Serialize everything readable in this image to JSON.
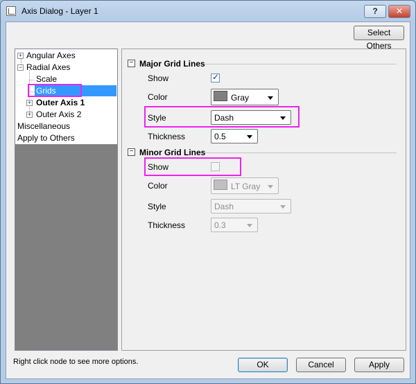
{
  "window": {
    "title": "Axis Dialog - Layer 1",
    "help_label": "?",
    "close_label": "✕"
  },
  "toolbar": {
    "select_others_label": "Select Others"
  },
  "tree": {
    "angular_axes": "Angular Axes",
    "radial_axes": "Radial Axes",
    "scale": "Scale",
    "grids": "Grids",
    "outer_axis_1": "Outer Axis 1",
    "outer_axis_2": "Outer Axis 2",
    "miscellaneous": "Miscellaneous",
    "apply_to_others": "Apply to Others",
    "expand_glyph": "+",
    "collapse_glyph": "−"
  },
  "major": {
    "title": "Major Grid Lines",
    "toggle_glyph": "−",
    "show_label": "Show",
    "show_checked": true,
    "color_label": "Color",
    "color_value": "Gray",
    "color_hex": "#808080",
    "style_label": "Style",
    "style_value": "Dash",
    "thickness_label": "Thickness",
    "thickness_value": "0.5"
  },
  "minor": {
    "title": "Minor Grid Lines",
    "toggle_glyph": "−",
    "show_label": "Show",
    "show_checked": false,
    "color_label": "Color",
    "color_value": "LT Gray",
    "color_hex": "#c0c0c0",
    "style_label": "Style",
    "style_value": "Dash",
    "thickness_label": "Thickness",
    "thickness_value": "0.3"
  },
  "footer": {
    "hint": "Right click node to see more options.",
    "ok_label": "OK",
    "cancel_label": "Cancel",
    "apply_label": "Apply"
  },
  "colors": {
    "highlight": "#ee22ee",
    "selection": "#3399ff"
  }
}
